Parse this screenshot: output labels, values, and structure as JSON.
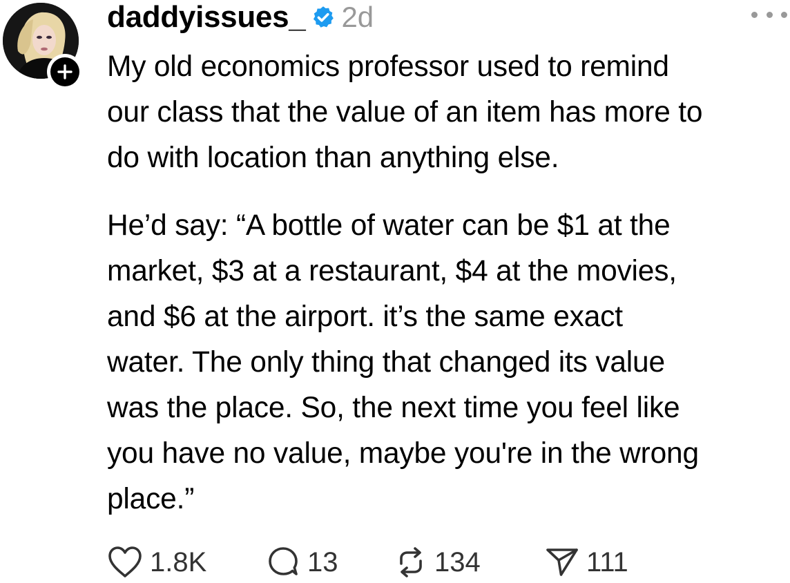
{
  "post": {
    "author": {
      "username": "daddyissues_",
      "verified": true,
      "verified_color": "#1D9BF0",
      "avatar_icon": "profile-photo"
    },
    "timestamp": "2d",
    "follow_icon": "plus-icon",
    "more_icon": "more-horizontal-icon",
    "paragraphs": [
      "My old economics professor used to remind\nour class that the value of an item has more to\ndo with location than anything else.",
      "He’d say:  “A bottle of water can be $1 at the\nmarket, $3 at a restaurant, $4 at the movies,\nand $6 at the airport. it’s the same exact\nwater. The only thing that changed its value\nwas the place. So, the next time you feel like\nyou have no value, maybe you're in the wrong\nplace.”"
    ],
    "actions": {
      "like": {
        "icon": "heart-icon",
        "count": "1.8K"
      },
      "reply": {
        "icon": "comment-icon",
        "count": "13"
      },
      "repost": {
        "icon": "repost-icon",
        "count": "134"
      },
      "share": {
        "icon": "send-icon",
        "count": "111"
      }
    },
    "colors": {
      "text": "#000000",
      "muted": "#999999",
      "count": "#333333"
    }
  }
}
